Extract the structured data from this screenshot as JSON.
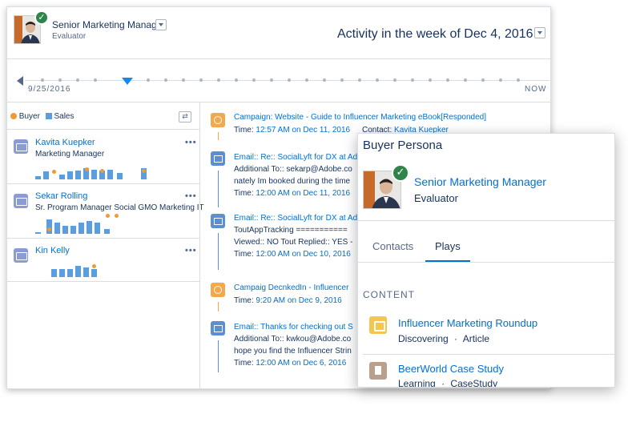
{
  "header": {
    "title": "Senior Marketing Manager",
    "subtitle": "Evaluator",
    "week_title": "Activity in the week of Dec 4, 2016"
  },
  "timeline": {
    "start_label": "9/25/2016",
    "end_label": "NOW"
  },
  "legend": {
    "buyer_label": "Buyer",
    "sales_label": "Sales",
    "buyer_color": "#f09a36",
    "sales_color": "#5b9ee0"
  },
  "contacts": [
    {
      "name": "Kavita Kuepker",
      "role": "Marketing Manager",
      "menu": "•••"
    },
    {
      "name": "Sekar Rolling",
      "role": "Sr. Program Manager Social GMO Marketing IT",
      "menu": "•••"
    },
    {
      "name": "Kin Kelly",
      "role": "",
      "menu": "•••"
    }
  ],
  "activities": [
    {
      "title": "Campaign: Website - Guide to Influencer Marketing eBook[Responded]",
      "time_label": "Time: ",
      "time": "12:57 AM on Dec 11, 2016",
      "contact_label": "Contact: ",
      "contact": "Kavita Kuepker"
    },
    {
      "title": "Email:: Re:: SocialLyft for DX at Ad",
      "line1": "Additional To:: sekarp@Adobe.co",
      "line2": "nately Im booked during the time",
      "time_label": "Time: ",
      "time": "12:00 AM on Dec 11, 2016"
    },
    {
      "title": "Email:: Re:: SocialLyft for DX at Ad",
      "line1": "ToutAppTracking ===========",
      "line2": "Viewed:: NO Tout Replied:: YES -",
      "time_label": "Time: ",
      "time": "12:00 AM on Dec 10, 2016"
    },
    {
      "title": "Campaig DecnkedIn - Influencer",
      "time_label": "Time: ",
      "time": "9:20 AM on  Dec 9, 2016"
    },
    {
      "title": "Email:: Thanks for checking out S",
      "line1": "Additional To:: kwkou@Adobe.co",
      "line2": "hope you find the Influencer Strin",
      "time_label": "Time: ",
      "time": "12:00 AM on  Dec 6, 2016"
    }
  ],
  "panel": {
    "heading": "Buyer Persona",
    "role": "Senior Marketing Manager",
    "subtitle": "Evaluator",
    "tabs": [
      "Contacts",
      "Plays"
    ],
    "active_tab": "Plays",
    "section_label": "CONTENT",
    "items": [
      {
        "title": "Influencer Marketing Roundup",
        "stage": "Discovering",
        "sep": "·",
        "type": "Article",
        "icon": "book-icon"
      },
      {
        "title": "BeerWorld Case Study",
        "stage": "Learning",
        "sep": "·",
        "type": "CaseStudy",
        "icon": "document-icon"
      }
    ]
  },
  "icons": {
    "check": "✓",
    "refresh": "⇄"
  }
}
